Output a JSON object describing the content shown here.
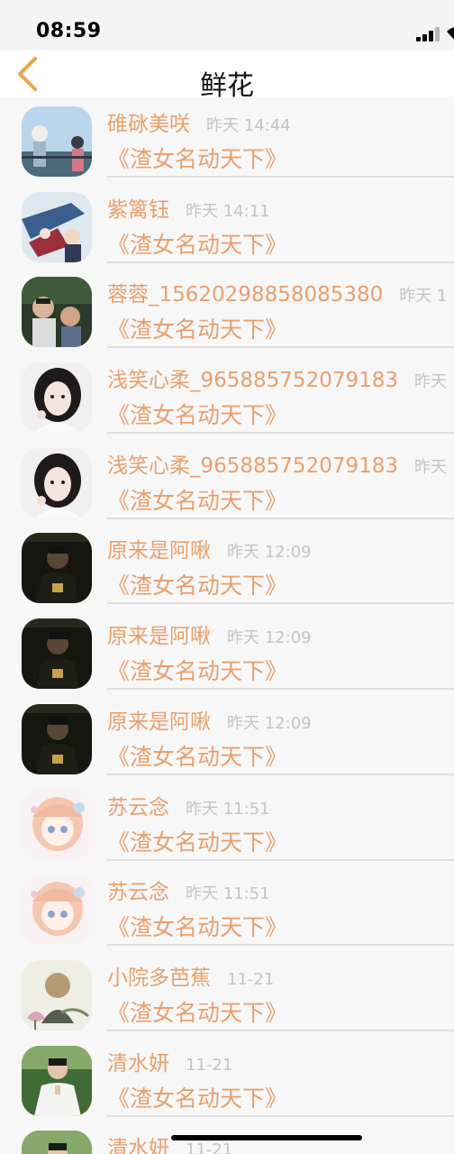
{
  "status": {
    "time": "08:59",
    "signal_bars": 4,
    "signal_active": 3
  },
  "nav": {
    "title": "鲜花",
    "back_icon": "chevron-left-icon",
    "accent_color": "#e9a44b"
  },
  "list": {
    "name_color": "#e9a06d",
    "time_color": "#c4c4c4",
    "items": [
      {
        "user": "碓砯美咲",
        "time": "昨天 14:44",
        "book": "《渣女名动天下》",
        "avatar": "anime-scene"
      },
      {
        "user": "紫篱钰",
        "time": "昨天 14:11",
        "book": "《渣女名动天下》",
        "avatar": "anime-art"
      },
      {
        "user": "蓉蓉_15620298858085380",
        "time": "昨天 1",
        "book": "《渣女名动天下》",
        "avatar": "kids-photo"
      },
      {
        "user": "浅笑心柔_965885752079183",
        "time": "昨天",
        "book": "《渣女名动天下》",
        "avatar": "girl-portrait"
      },
      {
        "user": "浅笑心柔_965885752079183",
        "time": "昨天",
        "book": "《渣女名动天下》",
        "avatar": "girl-portrait"
      },
      {
        "user": "原来是阿啾",
        "time": "昨天 12:09",
        "book": "《渣女名动天下》",
        "avatar": "man-dark"
      },
      {
        "user": "原来是阿啾",
        "time": "昨天 12:09",
        "book": "《渣女名动天下》",
        "avatar": "man-dark"
      },
      {
        "user": "原来是阿啾",
        "time": "昨天 12:09",
        "book": "《渣女名动天下》",
        "avatar": "man-dark"
      },
      {
        "user": "苏云念",
        "time": "昨天 11:51",
        "book": "《渣女名动天下》",
        "avatar": "anime-girl"
      },
      {
        "user": "苏云念",
        "time": "昨天 11:51",
        "book": "《渣女名动天下》",
        "avatar": "anime-girl"
      },
      {
        "user": "小院多芭蕉",
        "time": "11-21",
        "book": "《渣女名动天下》",
        "avatar": "monk-illustration"
      },
      {
        "user": "清水妍",
        "time": "11-21",
        "book": "《渣女名动天下》",
        "avatar": "man-white-shirt"
      },
      {
        "user": "清水妍",
        "time": "11-21",
        "book": "《渣女名动天下》",
        "avatar": "man-white-shirt"
      }
    ]
  }
}
